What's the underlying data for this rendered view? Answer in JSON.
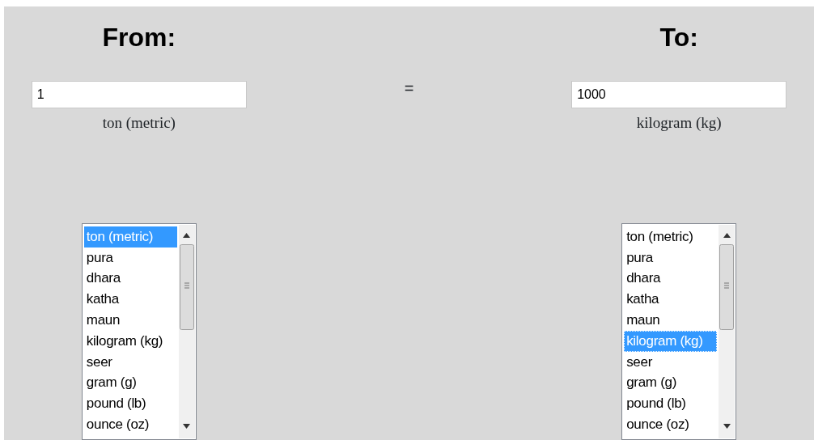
{
  "from": {
    "heading": "From:",
    "value": "1",
    "unit_label": "ton (metric)",
    "focused": false,
    "list": [
      {
        "label": "ton (metric)",
        "selected": true
      },
      {
        "label": "pura",
        "selected": false
      },
      {
        "label": "dhara",
        "selected": false
      },
      {
        "label": "katha",
        "selected": false
      },
      {
        "label": "maun",
        "selected": false
      },
      {
        "label": "kilogram (kg)",
        "selected": false
      },
      {
        "label": "seer",
        "selected": false
      },
      {
        "label": "gram (g)",
        "selected": false
      },
      {
        "label": "pound (lb)",
        "selected": false
      },
      {
        "label": "ounce (oz)",
        "selected": false
      }
    ]
  },
  "equals": "=",
  "to": {
    "heading": "To:",
    "value": "1000",
    "unit_label": "kilogram (kg)",
    "focused": true,
    "list": [
      {
        "label": "ton (metric)",
        "selected": false
      },
      {
        "label": "pura",
        "selected": false
      },
      {
        "label": "dhara",
        "selected": false
      },
      {
        "label": "katha",
        "selected": false
      },
      {
        "label": "maun",
        "selected": false
      },
      {
        "label": "kilogram (kg)",
        "selected": true
      },
      {
        "label": "seer",
        "selected": false
      },
      {
        "label": "gram (g)",
        "selected": false
      },
      {
        "label": "pound (lb)",
        "selected": false
      },
      {
        "label": "ounce (oz)",
        "selected": false
      }
    ]
  }
}
